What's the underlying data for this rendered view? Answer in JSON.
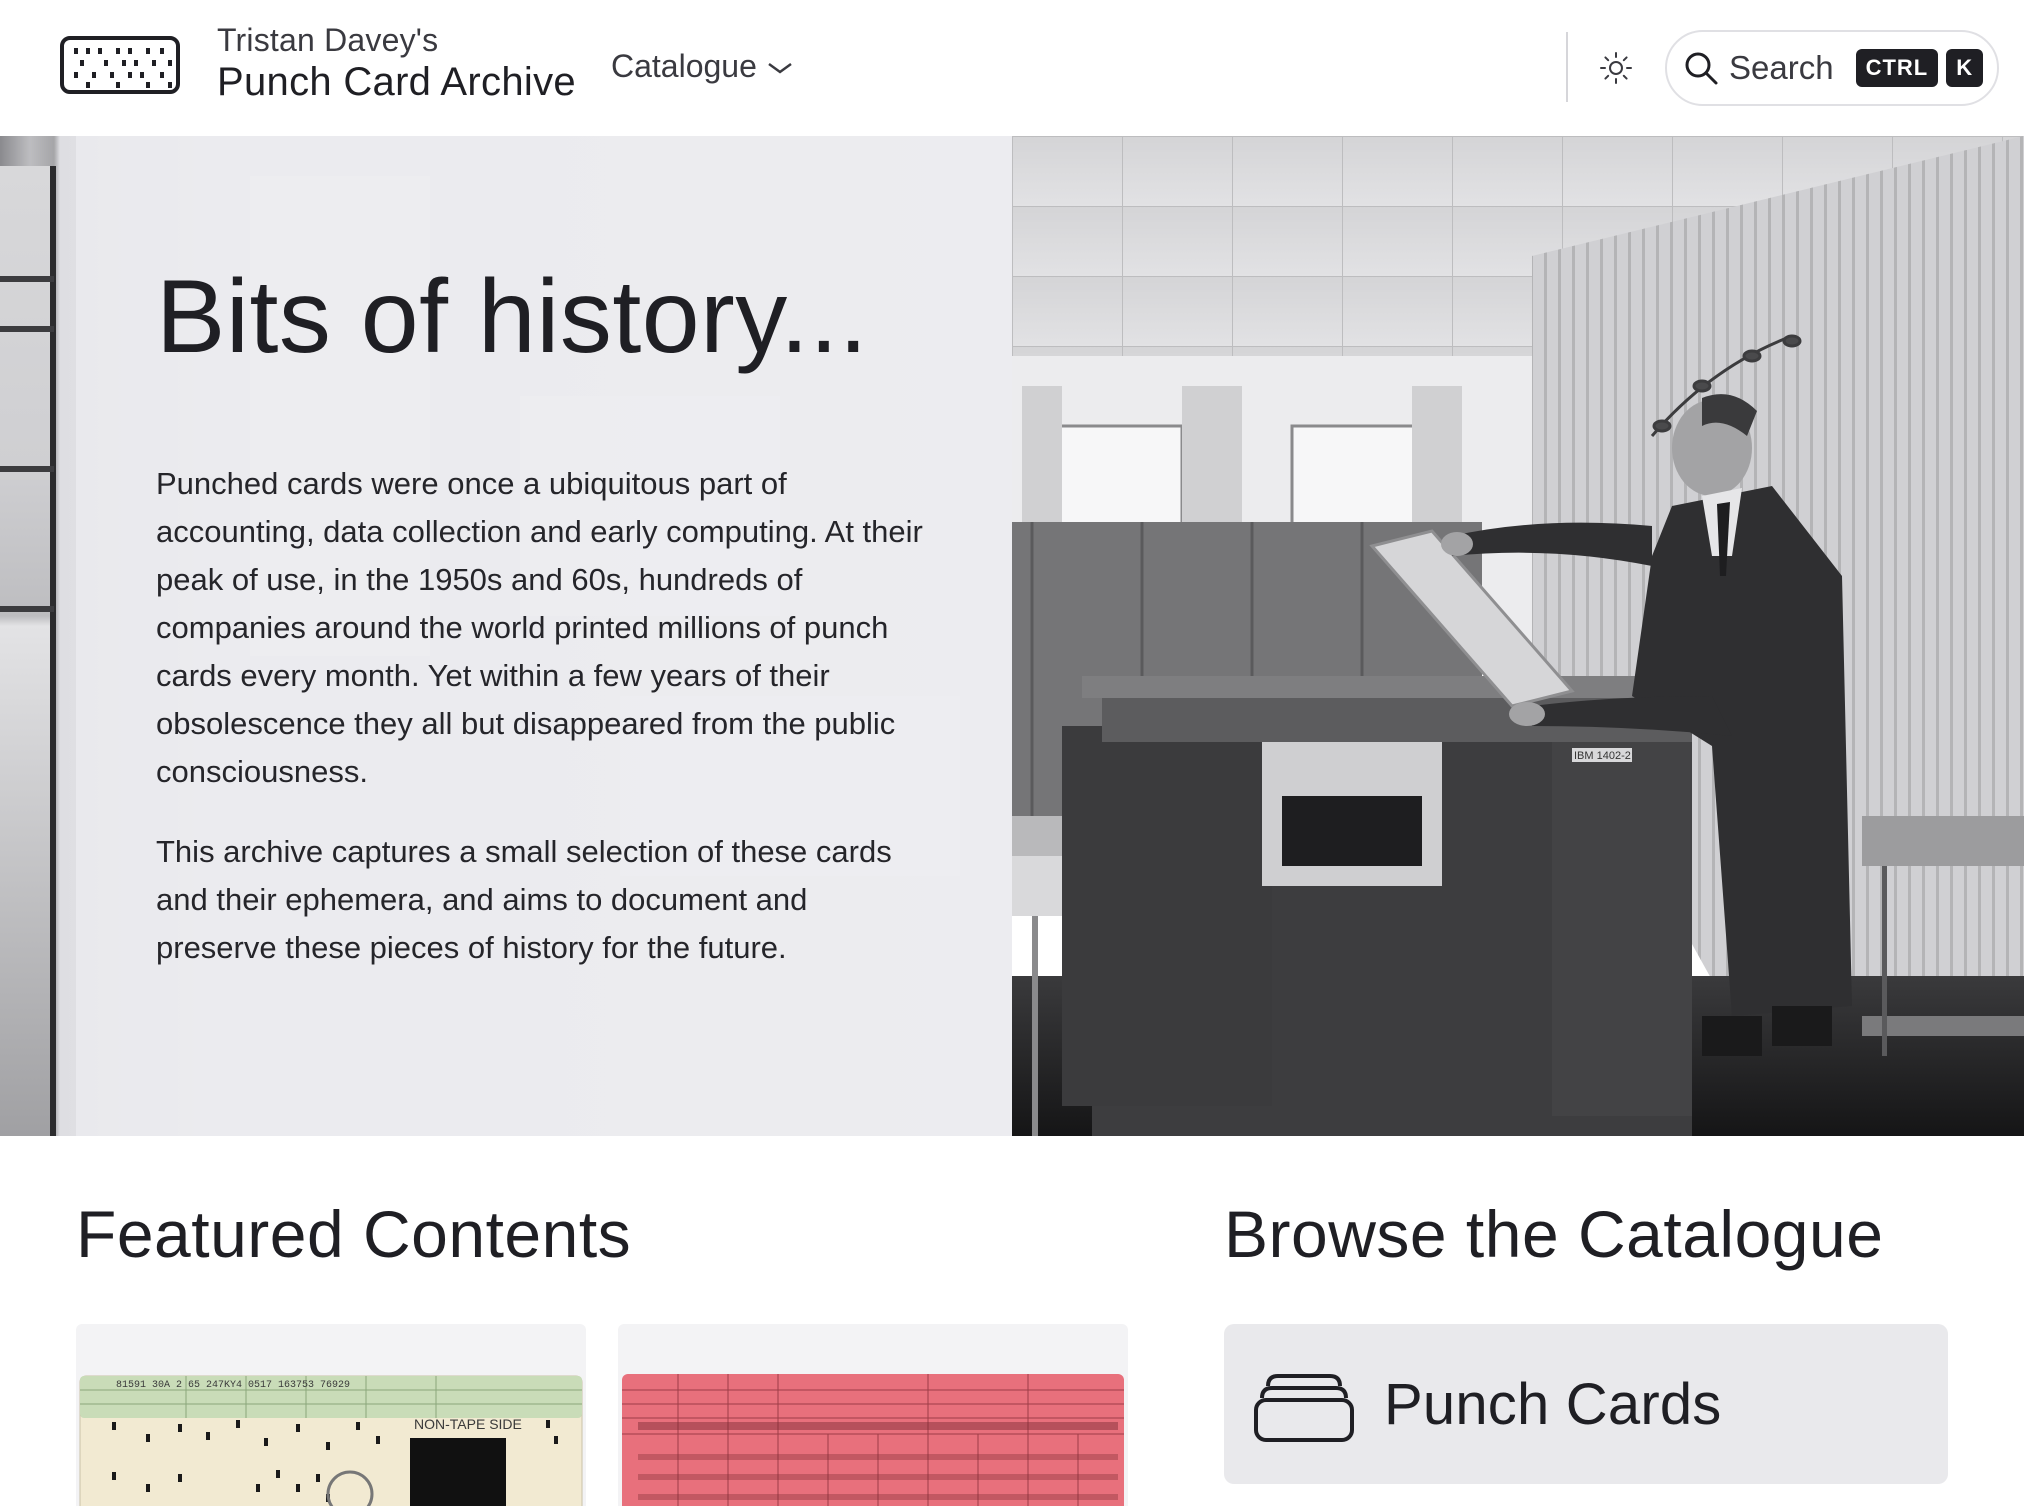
{
  "header": {
    "subtitle": "Tristan Davey's",
    "title": "Punch Card Archive",
    "nav_catalogue": "Catalogue",
    "search_label": "Search",
    "shortcut_key1": "CTRL",
    "shortcut_key2": "K"
  },
  "hero": {
    "title": "Bits of history...",
    "paragraph1": "Punched cards were once a ubiquitous part of accounting, data collection and early computing. At their peak of use, in the 1950s and 60s, hundreds of companies around the world printed millions of punch cards every month. Yet within a few years of their obsolescence they all but disappeared from the public consciousness.",
    "paragraph2": "This archive captures a small selection of these cards and their ephemera, and aims to document and preserve these pieces of history for the future.",
    "photo_machine_label": "IBM 1402-2"
  },
  "featured": {
    "title": "Featured Contents",
    "card1_side_label": "NON-TAPE SIDE",
    "card1_numbers": "81591   30A  2   65  247KY4  0517   163753  76929"
  },
  "browse": {
    "title": "Browse the Catalogue",
    "item1_label": "Punch Cards"
  },
  "colors": {
    "text": "#1f1f24",
    "panel": "#ececef",
    "red_card": "#e8707c",
    "cream_card": "#f2ead2",
    "green_band": "#c9dcb8"
  },
  "icons": [
    "punch-card-logo-icon",
    "chevron-down-icon",
    "sun-icon",
    "search-icon",
    "card-stack-icon"
  ]
}
